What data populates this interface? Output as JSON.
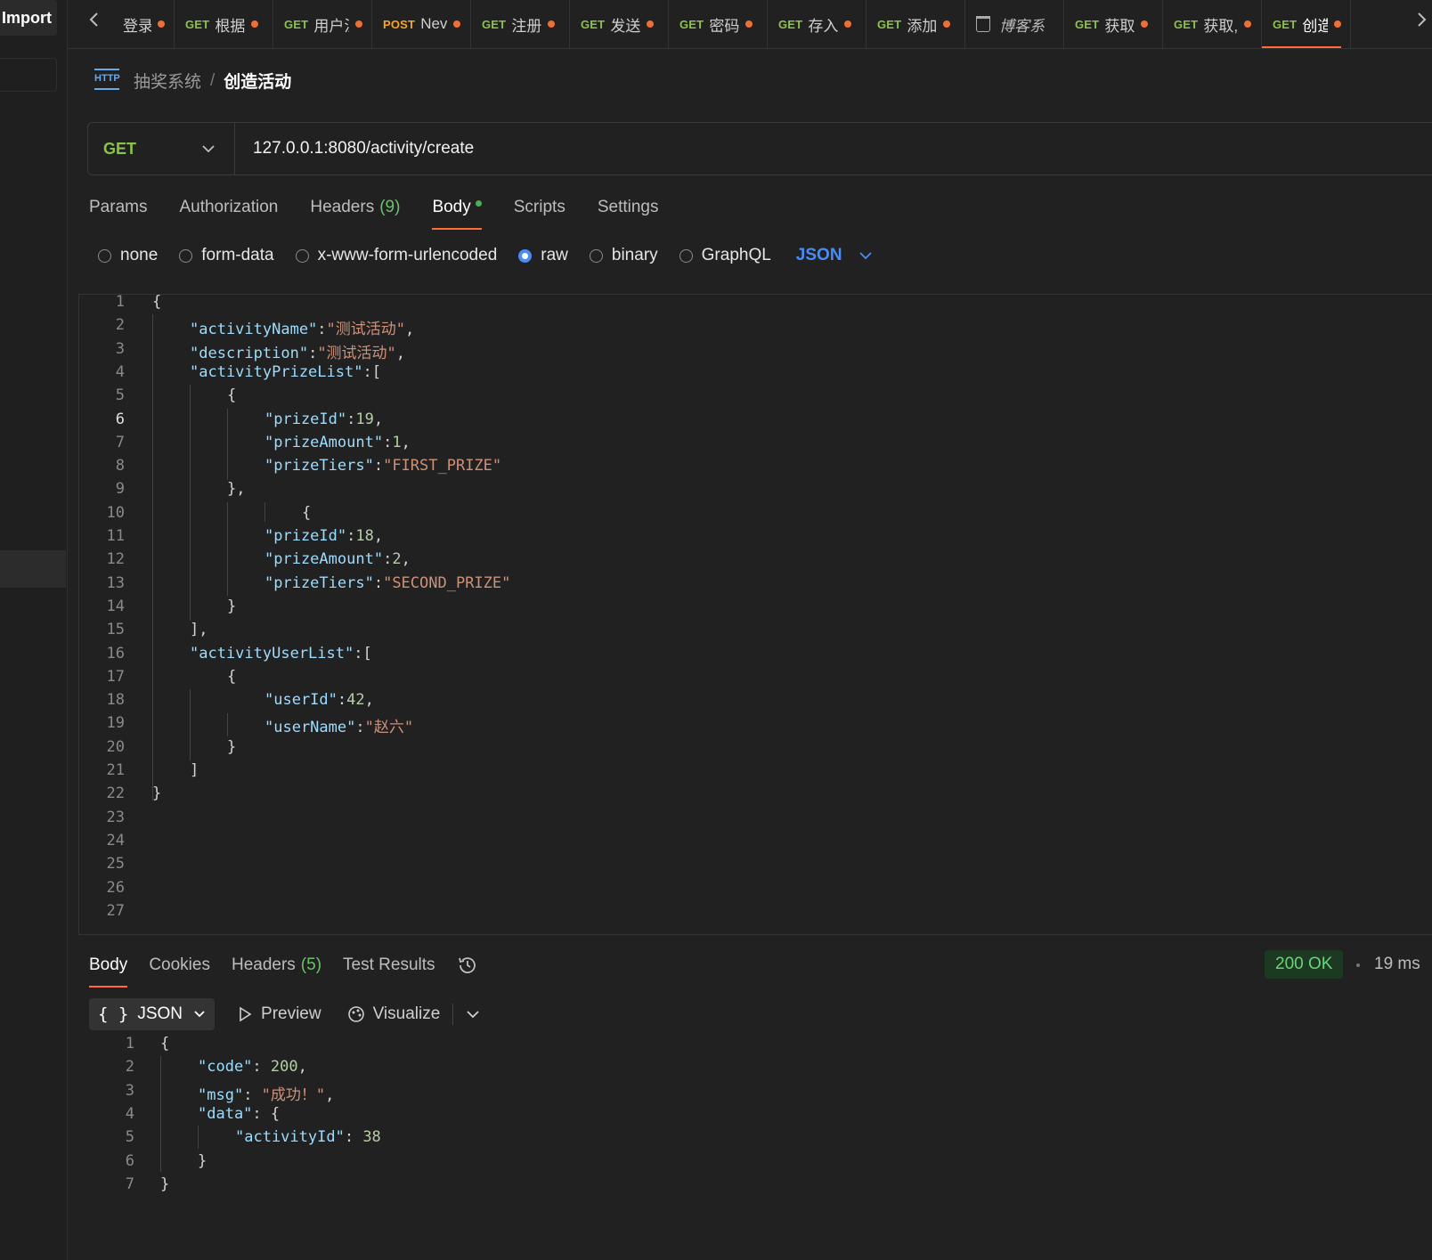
{
  "sidebar": {
    "import_label": "Import"
  },
  "tabs": [
    {
      "method": "",
      "title": "登录",
      "dot": true
    },
    {
      "method": "GET",
      "title": "根据",
      "dot": true
    },
    {
      "method": "GET",
      "title": "用户注",
      "dot": true
    },
    {
      "method": "POST",
      "title": "Nev",
      "dot": true
    },
    {
      "method": "GET",
      "title": "注册",
      "dot": true
    },
    {
      "method": "GET",
      "title": "发送",
      "dot": true
    },
    {
      "method": "GET",
      "title": "密码",
      "dot": true
    },
    {
      "method": "GET",
      "title": "存入",
      "dot": true
    },
    {
      "method": "GET",
      "title": "添加",
      "dot": true
    },
    {
      "method": "",
      "title": "博客系",
      "dot": false,
      "icon": "collection-icon"
    },
    {
      "method": "GET",
      "title": "获取",
      "dot": true
    },
    {
      "method": "GET",
      "title": "获取,",
      "dot": true
    },
    {
      "method": "GET",
      "title": "创造",
      "dot": true,
      "active": true
    }
  ],
  "breadcrumb": {
    "collection": "抽奖系统",
    "separator": "/",
    "request": "创造活动",
    "icon_text": "HTTP"
  },
  "request": {
    "method": "GET",
    "url": "127.0.0.1:8080/activity/create"
  },
  "request_tabs": [
    {
      "label": "Params"
    },
    {
      "label": "Authorization"
    },
    {
      "label": "Headers",
      "count": "(9)"
    },
    {
      "label": "Body",
      "active": true,
      "dot": true
    },
    {
      "label": "Scripts"
    },
    {
      "label": "Settings"
    }
  ],
  "body_types": [
    {
      "label": "none",
      "selected": false
    },
    {
      "label": "form-data",
      "selected": false
    },
    {
      "label": "x-www-form-urlencoded",
      "selected": false
    },
    {
      "label": "raw",
      "selected": true
    },
    {
      "label": "binary",
      "selected": false
    },
    {
      "label": "GraphQL",
      "selected": false
    }
  ],
  "body_format": "JSON",
  "request_body": {
    "line_numbers": [
      "1",
      "2",
      "3",
      "4",
      "5",
      "6",
      "7",
      "8",
      "9",
      "10",
      "11",
      "12",
      "13",
      "14",
      "15",
      "16",
      "17",
      "18",
      "19",
      "20",
      "21",
      "22",
      "23",
      "24",
      "25",
      "26",
      "27"
    ],
    "current_line": "6",
    "lines": [
      [
        {
          "c": "p",
          "t": "{"
        }
      ],
      [
        {
          "c": "k",
          "t": "\"activityName\""
        },
        {
          "c": "p",
          "t": ":"
        },
        {
          "c": "s",
          "t": "\"测试活动\""
        },
        {
          "c": "p",
          "t": ","
        }
      ],
      [
        {
          "c": "k",
          "t": "\"description\""
        },
        {
          "c": "p",
          "t": ":"
        },
        {
          "c": "s",
          "t": "\"测试活动\""
        },
        {
          "c": "p",
          "t": ","
        }
      ],
      [
        {
          "c": "k",
          "t": "\"activityPrizeList\""
        },
        {
          "c": "p",
          "t": ":["
        }
      ],
      [
        {
          "c": "p",
          "t": "{"
        }
      ],
      [
        {
          "c": "k",
          "t": "\"prizeId\""
        },
        {
          "c": "p",
          "t": ":"
        },
        {
          "c": "n",
          "t": "19"
        },
        {
          "c": "p",
          "t": ","
        }
      ],
      [
        {
          "c": "k",
          "t": "\"prizeAmount\""
        },
        {
          "c": "p",
          "t": ":"
        },
        {
          "c": "n",
          "t": "1"
        },
        {
          "c": "p",
          "t": ","
        }
      ],
      [
        {
          "c": "k",
          "t": "\"prizeTiers\""
        },
        {
          "c": "p",
          "t": ":"
        },
        {
          "c": "s",
          "t": "\"FIRST_PRIZE\""
        }
      ],
      [
        {
          "c": "p",
          "t": "},"
        }
      ],
      [
        {
          "c": "p",
          "t": "{"
        }
      ],
      [
        {
          "c": "k",
          "t": "\"prizeId\""
        },
        {
          "c": "p",
          "t": ":"
        },
        {
          "c": "n",
          "t": "18"
        },
        {
          "c": "p",
          "t": ","
        }
      ],
      [
        {
          "c": "k",
          "t": "\"prizeAmount\""
        },
        {
          "c": "p",
          "t": ":"
        },
        {
          "c": "n",
          "t": "2"
        },
        {
          "c": "p",
          "t": ","
        }
      ],
      [
        {
          "c": "k",
          "t": "\"prizeTiers\""
        },
        {
          "c": "p",
          "t": ":"
        },
        {
          "c": "s",
          "t": "\"SECOND_PRIZE\""
        }
      ],
      [
        {
          "c": "p",
          "t": "}"
        }
      ],
      [
        {
          "c": "p",
          "t": "],"
        }
      ],
      [
        {
          "c": "k",
          "t": "\"activityUserList\""
        },
        {
          "c": "p",
          "t": ":["
        }
      ],
      [
        {
          "c": "p",
          "t": "{"
        }
      ],
      [
        {
          "c": "k",
          "t": "\"userId\""
        },
        {
          "c": "p",
          "t": ":"
        },
        {
          "c": "n",
          "t": "42"
        },
        {
          "c": "p",
          "t": ","
        }
      ],
      [
        {
          "c": "k",
          "t": "\"userName\""
        },
        {
          "c": "p",
          "t": ":"
        },
        {
          "c": "s",
          "t": "\"赵六\""
        }
      ],
      [
        {
          "c": "p",
          "t": "}"
        }
      ],
      [
        {
          "c": "p",
          "t": "]"
        }
      ],
      [
        {
          "c": "p",
          "t": "}"
        }
      ]
    ]
  },
  "response_tabs": [
    {
      "label": "Body",
      "active": true
    },
    {
      "label": "Cookies"
    },
    {
      "label": "Headers",
      "count": "(5)"
    },
    {
      "label": "Test Results"
    }
  ],
  "response_status": {
    "status": "200 OK",
    "time": "19 ms",
    "status_color": "#6cd27a"
  },
  "response_toolbar": {
    "format": "JSON",
    "format_icon": "{ }",
    "preview": "Preview",
    "visualize": "Visualize"
  },
  "response_body": {
    "line_numbers": [
      "1",
      "2",
      "3",
      "4",
      "5",
      "6",
      "7"
    ],
    "lines": [
      [
        {
          "c": "p",
          "t": "{"
        }
      ],
      [
        {
          "c": "k",
          "t": "\"code\""
        },
        {
          "c": "p",
          "t": ": "
        },
        {
          "c": "n",
          "t": "200"
        },
        {
          "c": "p",
          "t": ","
        }
      ],
      [
        {
          "c": "k",
          "t": "\"msg\""
        },
        {
          "c": "p",
          "t": ": "
        },
        {
          "c": "s",
          "t": "\"成功！\""
        },
        {
          "c": "p",
          "t": ","
        }
      ],
      [
        {
          "c": "k",
          "t": "\"data\""
        },
        {
          "c": "p",
          "t": ": {"
        }
      ],
      [
        {
          "c": "k",
          "t": "\"activityId\""
        },
        {
          "c": "p",
          "t": ": "
        },
        {
          "c": "n",
          "t": "38"
        }
      ],
      [
        {
          "c": "p",
          "t": "}"
        }
      ],
      [
        {
          "c": "p",
          "t": "}"
        }
      ]
    ]
  },
  "colors": {
    "accent": "#ff6c37",
    "get": "#8bc34a",
    "post": "#f5a623",
    "link": "#4a8cf7"
  }
}
